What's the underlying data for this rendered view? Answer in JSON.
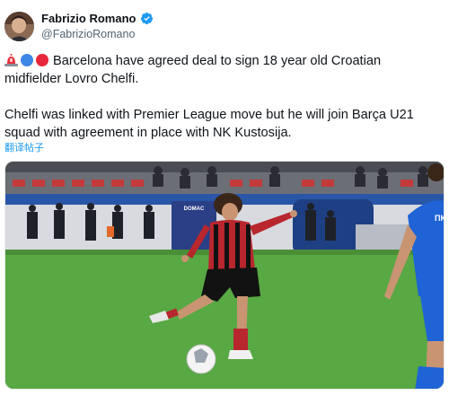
{
  "author": {
    "display_name": "Fabrizio Romano",
    "handle": "@FabrizioRomano",
    "verified": true,
    "avatar_icon": "author-avatar"
  },
  "tweet": {
    "emojis": [
      "siren-emoji",
      "blue-circle-emoji",
      "red-circle-emoji"
    ],
    "line1": "Barcelona have agreed deal to sign 18 year old Croatian",
    "line2": "midfielder Lovro Chelfi.",
    "line3": "Chelfi was linked with Premier League move but he will join Barça U21",
    "line4": "squad with agreement in place with NK Kustosija."
  },
  "translate_label": "翻译帖子",
  "media": {
    "description_icon": "football-photo",
    "board_text": "DOMAC",
    "jersey_text": "ПК"
  },
  "colors": {
    "link": "#1d9bf0",
    "handle": "#536471",
    "verified": "#1d9bf0"
  }
}
